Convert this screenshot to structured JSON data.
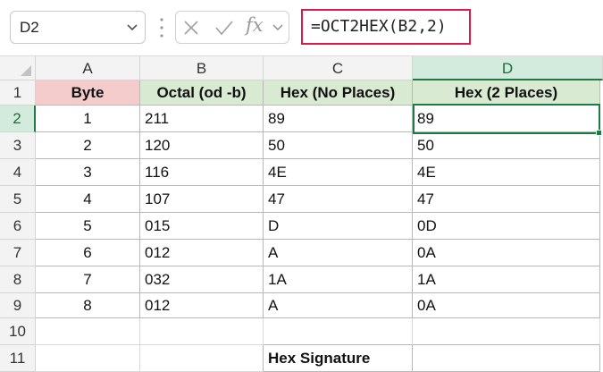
{
  "formula_bar": {
    "name_box": "D2",
    "formula": "=OCT2HEX(B2,2)"
  },
  "icons": {
    "name_box_dropdown": "chevron-down-icon",
    "cancel": "close-icon",
    "enter": "check-icon",
    "insert_function": "fx-icon",
    "formula_expand": "chevron-down-icon"
  },
  "colors": {
    "byte_header_fill": "#f4cccc",
    "header_fill": "#d9ead3",
    "selection_green": "#1d7a43",
    "formula_highlight": "#d81b4b"
  },
  "fx_label": "fx",
  "columns": [
    "A",
    "B",
    "C",
    "D"
  ],
  "rows": [
    "1",
    "2",
    "3",
    "4",
    "5",
    "6",
    "7",
    "8",
    "9",
    "10",
    "11"
  ],
  "headers": {
    "byte": "Byte",
    "octal": "Octal (od -b)",
    "hex_no_places": "Hex (No Places)",
    "hex_2_places": "Hex (2 Places)"
  },
  "data": [
    {
      "byte": "1",
      "octal": "211",
      "hex": "89",
      "hex2": "89"
    },
    {
      "byte": "2",
      "octal": "120",
      "hex": "50",
      "hex2": "50"
    },
    {
      "byte": "3",
      "octal": "116",
      "hex": "4E",
      "hex2": "4E"
    },
    {
      "byte": "4",
      "octal": "107",
      "hex": "47",
      "hex2": "47"
    },
    {
      "byte": "5",
      "octal": "015",
      "hex": "D",
      "hex2": "0D"
    },
    {
      "byte": "6",
      "octal": "012",
      "hex": "A",
      "hex2": "0A"
    },
    {
      "byte": "7",
      "octal": "032",
      "hex": "1A",
      "hex2": "1A"
    },
    {
      "byte": "8",
      "octal": "012",
      "hex": "A",
      "hex2": "0A"
    }
  ],
  "summary": {
    "hex_signature_label": "Hex Signature",
    "hex_signature_value": ""
  },
  "selection": {
    "active_cell": "D2",
    "active_column": "D",
    "active_row": "2"
  }
}
